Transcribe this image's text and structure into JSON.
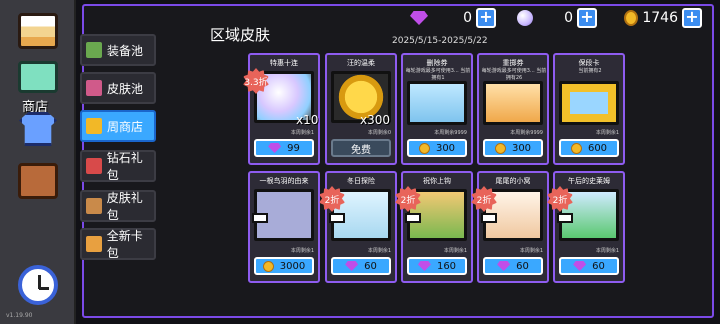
{
  "rail": {
    "shop_label": "商店",
    "version": "v1.19.90"
  },
  "currency": {
    "gems": "0",
    "orbs": "0",
    "coins": "1746",
    "plus": "+"
  },
  "section_title": "区域皮肤",
  "date_range": "2025/5/15-2025/5/22",
  "tabs": [
    {
      "label": "装备池",
      "icon_color": "#6aa84f"
    },
    {
      "label": "皮肤池",
      "icon_color": "#d05a8a"
    },
    {
      "label": "周商店",
      "icon_color": "#f2b827"
    },
    {
      "label": "钻石礼包",
      "icon_color": "#d84a4a"
    },
    {
      "label": "皮肤礼包",
      "icon_color": "#c98a4a"
    },
    {
      "label": "全新卡包",
      "icon_color": "#e8a040"
    }
  ],
  "cards": [
    {
      "title": "特惠十连",
      "desc": "",
      "stock": "本周剩余1",
      "price": "99",
      "currency": "gem",
      "badge": "3.3折",
      "qty": "x10",
      "art": "gem-orb"
    },
    {
      "title": "汪的温柔",
      "desc": "",
      "stock": "本周剩余0",
      "price": "免费",
      "currency": "none",
      "badge": "",
      "qty": "x300",
      "art": "gold-coin"
    },
    {
      "title": "删除券",
      "desc": "每轮游戏最多可使用3... 当前拥有1",
      "stock": "本周剩余9999",
      "price": "300",
      "currency": "coin",
      "badge": "",
      "qty": "",
      "art": "ticket-blue"
    },
    {
      "title": "重掷券",
      "desc": "每轮游戏最多可使用3... 当前拥有26",
      "stock": "本周剩余9999",
      "price": "300",
      "currency": "coin",
      "badge": "",
      "qty": "",
      "art": "ticket-orange"
    },
    {
      "title": "保段卡",
      "desc": "当前拥有2",
      "stock": "本周剩余1",
      "price": "600",
      "currency": "coin",
      "badge": "",
      "qty": "",
      "art": "frame-card"
    },
    {
      "title": "一根鸟羽的由来",
      "desc": "",
      "stock": "本周剩余1",
      "price": "3000",
      "currency": "coin",
      "badge": "",
      "qty": "",
      "art": "feather"
    },
    {
      "title": "冬日探险",
      "desc": "",
      "stock": "本周剩余1",
      "price": "60",
      "currency": "gem",
      "badge": "2折",
      "qty": "",
      "art": "winter"
    },
    {
      "title": "祝你上钩",
      "desc": "",
      "stock": "本周剩余1",
      "price": "160",
      "currency": "gem",
      "badge": "2折",
      "qty": "",
      "art": "fishing"
    },
    {
      "title": "尾尾的小窝",
      "desc": "",
      "stock": "本周剩余1",
      "price": "60",
      "currency": "gem",
      "badge": "2折",
      "qty": "",
      "art": "fox"
    },
    {
      "title": "午后的史莱姆",
      "desc": "",
      "stock": "本周剩余1",
      "price": "60",
      "currency": "gem",
      "badge": "2折",
      "qty": "",
      "art": "slime"
    }
  ]
}
